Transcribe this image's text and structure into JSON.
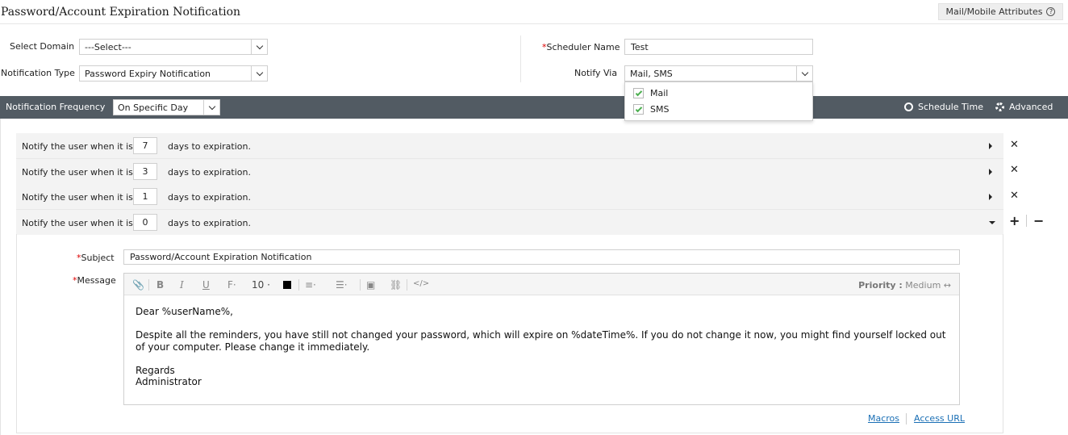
{
  "page": {
    "title": "Password/Account Expiration Notification"
  },
  "header": {
    "attributes_button": "Mail/Mobile Attributes"
  },
  "form": {
    "domain_label": "Select Domain",
    "domain_value": "---Select---",
    "type_label": "Notification Type",
    "type_value": "Password Expiry Notification",
    "scheduler_label": "Scheduler Name",
    "scheduler_value": "Test",
    "notify_label": "Notify Via",
    "notify_value": "Mail, SMS",
    "notify_options": [
      {
        "label": "Mail",
        "checked": true
      },
      {
        "label": "SMS",
        "checked": true
      }
    ]
  },
  "frequency": {
    "label": "Notification Frequency",
    "value": "On Specific Day",
    "schedule_time": "Schedule Time",
    "advanced": "Advanced"
  },
  "rules": [
    {
      "prefix": "Notify the user when it is",
      "days": "7",
      "suffix": "days to expiration."
    },
    {
      "prefix": "Notify the user when it is",
      "days": "3",
      "suffix": "days to expiration."
    },
    {
      "prefix": "Notify the user when it is",
      "days": "1",
      "suffix": "days to expiration."
    },
    {
      "prefix": "Notify the user when it is",
      "days": "0",
      "suffix": "days to expiration."
    }
  ],
  "mail": {
    "subject_label": "Subject",
    "subject_value": "Password/Account Expiration Notification",
    "message_label": "Message",
    "font_size": "10",
    "priority_label": "Priority :",
    "priority_value": "Medium",
    "body": {
      "greeting": "Dear %userName%,",
      "paragraph": "Despite all the reminders, you have still not changed your password, which will expire on %dateTime%. If you do not change it now, you might find yourself locked out of your computer. Please change it immediately.",
      "closing": "Regards",
      "signature": "Administrator"
    },
    "macros_link": "Macros",
    "access_url_link": "Access URL"
  },
  "colors": {
    "header_bar": "#525b63",
    "link": "#1a6fb5",
    "required": "#dd0000",
    "check": "#4caf50"
  }
}
